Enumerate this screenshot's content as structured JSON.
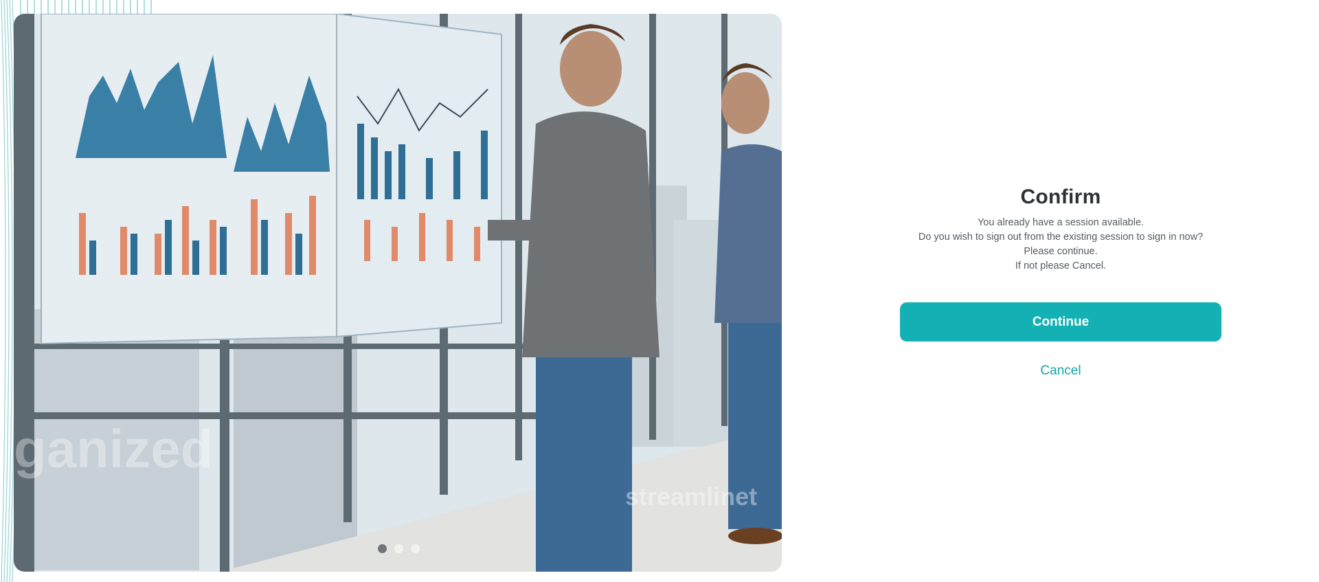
{
  "hero": {
    "watermarks": [
      "ganized",
      "streamlinet"
    ],
    "carousel": {
      "total": 3,
      "active": 1
    }
  },
  "confirm": {
    "title": "Confirm",
    "lines": [
      "You already have a session available.",
      "Do you wish to sign out from the existing session to sign in now?",
      "Please continue.",
      "If not please Cancel."
    ],
    "continue_label": "Continue",
    "cancel_label": "Cancel"
  },
  "colors": {
    "accent": "#13b1b3",
    "link": "#13a6a8",
    "title": "#2f3234",
    "text": "#555b60"
  }
}
